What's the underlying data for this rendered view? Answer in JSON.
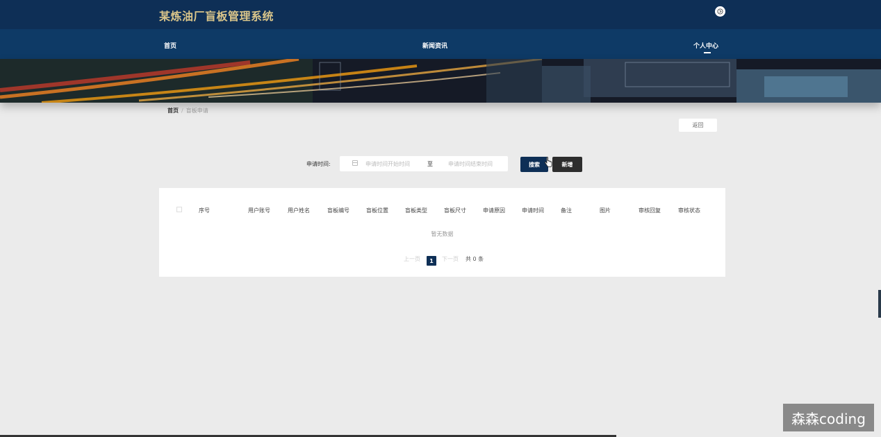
{
  "header": {
    "site_title": "某炼油厂盲板管理系统",
    "user_icon": "user-circle-icon"
  },
  "nav": {
    "items": [
      {
        "label": "首页"
      },
      {
        "label": "新闻资讯"
      },
      {
        "label": "个人中心",
        "active": true
      }
    ]
  },
  "breadcrumb": {
    "home": "首页",
    "separator": "/",
    "current": "盲板申请"
  },
  "actions": {
    "back_label": "返回"
  },
  "search": {
    "label": "申请时间:",
    "start_placeholder": "申请时间开始时间",
    "range_separator": "至",
    "end_placeholder": "申请时间结束时间",
    "search_label": "搜索",
    "add_label": "新增"
  },
  "table": {
    "columns": [
      "序号",
      "用户账号",
      "用户姓名",
      "盲板编号",
      "盲板位置",
      "盲板类型",
      "盲板尺寸",
      "申请原因",
      "申请时间",
      "备注",
      "图片",
      "审核回复",
      "审核状态"
    ],
    "rows": [],
    "empty_text": "暂无数据"
  },
  "pagination": {
    "prev_label": "上一页",
    "current_page": "1",
    "next_label": "下一页",
    "total_text": "共 0 条"
  },
  "watermark": "森森coding",
  "colors": {
    "header_bg": "#0e2f56",
    "nav_bg": "#0e3a66",
    "title_gold": "#d9c58a",
    "primary": "#0e2f56",
    "add_button": "#2d2d2d",
    "page_bg": "#ebebeb"
  }
}
